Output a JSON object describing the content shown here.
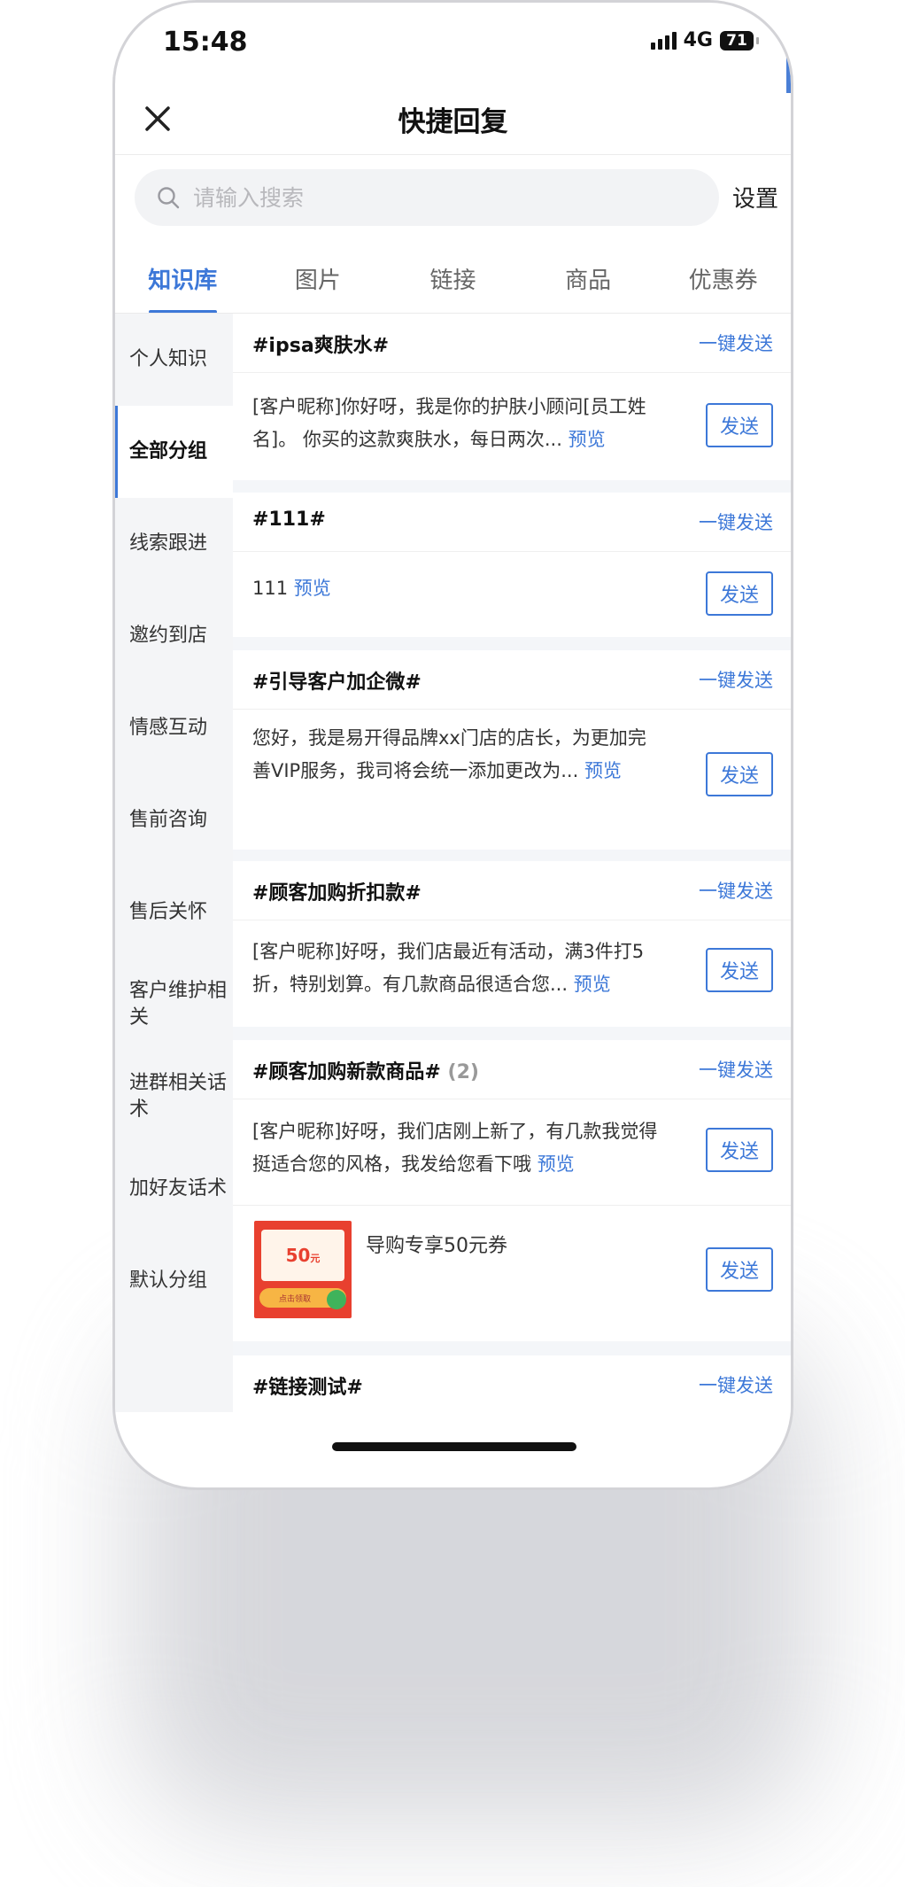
{
  "status": {
    "time": "15:48",
    "network": "4G",
    "battery": "71"
  },
  "nav": {
    "title": "快捷回复"
  },
  "search": {
    "placeholder": "请输入搜索",
    "settings_label": "设置"
  },
  "tabs": [
    {
      "label": "知识库",
      "active": true
    },
    {
      "label": "图片",
      "active": false
    },
    {
      "label": "链接",
      "active": false
    },
    {
      "label": "商品",
      "active": false
    },
    {
      "label": "优惠券",
      "active": false
    }
  ],
  "sidebar": {
    "items": [
      {
        "label": "个人知识"
      },
      {
        "label": "全部分组",
        "active": true
      },
      {
        "label": "线索跟进"
      },
      {
        "label": "邀约到店"
      },
      {
        "label": "情感互动"
      },
      {
        "label": "售前咨询"
      },
      {
        "label": "售后关怀"
      },
      {
        "label": "客户维护相关"
      },
      {
        "label": "进群相关话术"
      },
      {
        "label": "加好友话术"
      },
      {
        "label": "默认分组"
      }
    ]
  },
  "common": {
    "quick_send": "一键发送",
    "send": "发送",
    "preview": "预览"
  },
  "cards": [
    {
      "title": "#ipsa爽肤水#",
      "text": "[客户昵称]你好呀，我是你的护肤小顾问[员工姓名]。 你买的这款爽肤水，每日两次..."
    },
    {
      "title": "#111#",
      "text": "111"
    },
    {
      "title": "#引导客户加企微#",
      "text": "您好，我是易开得品牌xx门店的店长，为更加完善VIP服务，我司将会统一添加更改为..."
    },
    {
      "title": "#顾客加购折扣款#",
      "text": "[客户昵称]好呀，我们店最近有活动，满3件打5折，特别划算。有几款商品很适合您..."
    },
    {
      "title": "#顾客加购新款商品#",
      "count": "(2)",
      "text": "[客户昵称]好呀，我们店刚上新了，有几款我觉得挺适合您的风格，我发给您看下哦",
      "coupon_title": "导购专享50元券",
      "coupon_value": "50",
      "coupon_unit": "元",
      "coupon_button": "点击领取"
    },
    {
      "title": "#链接测试#"
    }
  ],
  "colors": {
    "accent": "#3d78d8",
    "sidebar_bg": "#f4f5f7"
  }
}
